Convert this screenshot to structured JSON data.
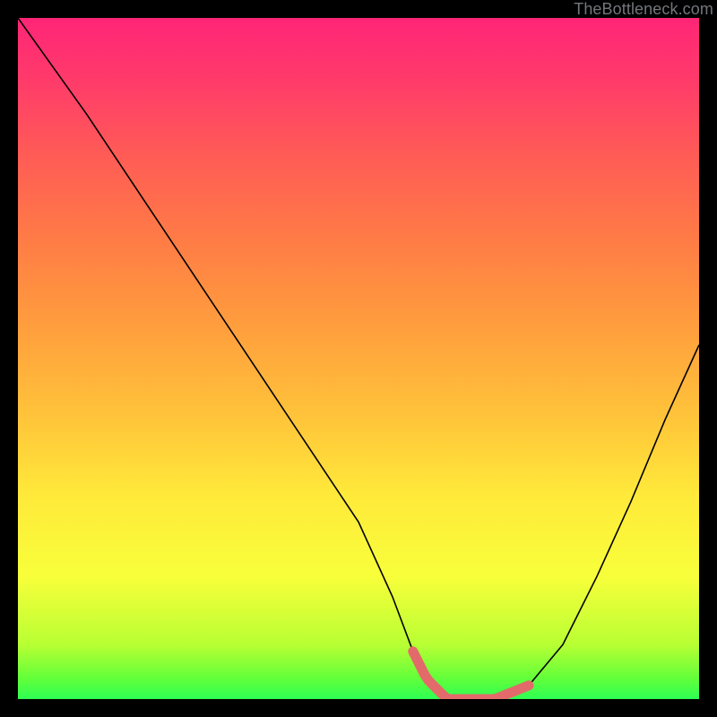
{
  "attribution": "TheBottleneck.com",
  "chart_data": {
    "type": "line",
    "title": "",
    "xlabel": "",
    "ylabel": "",
    "xlim": [
      0,
      100
    ],
    "ylim": [
      0,
      100
    ],
    "x": [
      0,
      10,
      20,
      30,
      40,
      50,
      55,
      58,
      60,
      63,
      67,
      70,
      75,
      80,
      85,
      90,
      95,
      100
    ],
    "values": [
      100,
      86,
      71,
      56,
      41,
      26,
      15,
      7,
      3,
      0,
      0,
      0,
      2,
      8,
      18,
      29,
      41,
      52
    ],
    "optimal_region": {
      "x_start": 58,
      "x_end": 75
    },
    "gradient_colors": {
      "top": "#ff2577",
      "bottom": "#2dff53"
    }
  }
}
